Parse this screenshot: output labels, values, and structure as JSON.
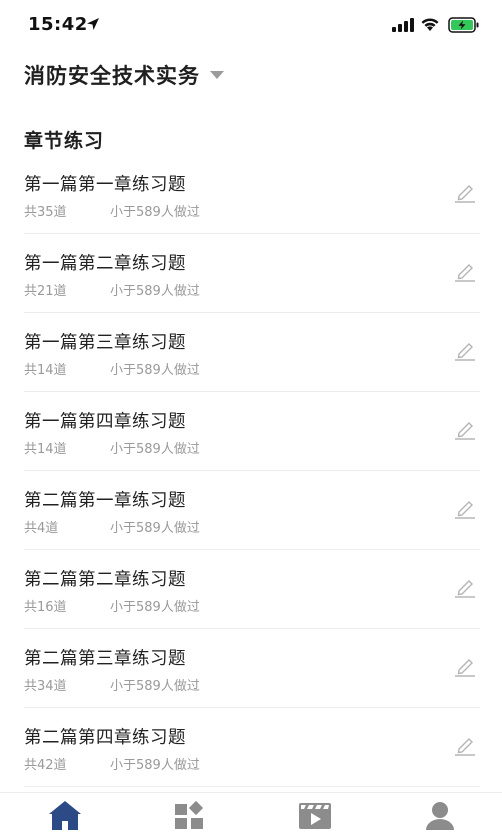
{
  "status": {
    "time": "15:42"
  },
  "header": {
    "title": "消防安全技术实务"
  },
  "section": {
    "title": "章节练习"
  },
  "items": [
    {
      "title": "第一篇第一章练习题",
      "count": "共35道",
      "people": "小于589人做过"
    },
    {
      "title": "第一篇第二章练习题",
      "count": "共21道",
      "people": "小于589人做过"
    },
    {
      "title": "第一篇第三章练习题",
      "count": "共14道",
      "people": "小于589人做过"
    },
    {
      "title": "第一篇第四章练习题",
      "count": "共14道",
      "people": "小于589人做过"
    },
    {
      "title": "第二篇第一章练习题",
      "count": "共4道",
      "people": "小于589人做过"
    },
    {
      "title": "第二篇第二章练习题",
      "count": "共16道",
      "people": "小于589人做过"
    },
    {
      "title": "第二篇第三章练习题",
      "count": "共34道",
      "people": "小于589人做过"
    },
    {
      "title": "第二篇第四章练习题",
      "count": "共42道",
      "people": "小于589人做过"
    }
  ],
  "tabs": [
    {
      "icon": "home-icon",
      "active": true
    },
    {
      "icon": "grid-icon",
      "active": false
    },
    {
      "icon": "video-icon",
      "active": false
    },
    {
      "icon": "profile-icon",
      "active": false
    }
  ],
  "colors": {
    "accent": "#2c4a86",
    "battery": "#34c759",
    "muted": "#9a9a9a",
    "icon_inactive": "#8c8c8c"
  }
}
